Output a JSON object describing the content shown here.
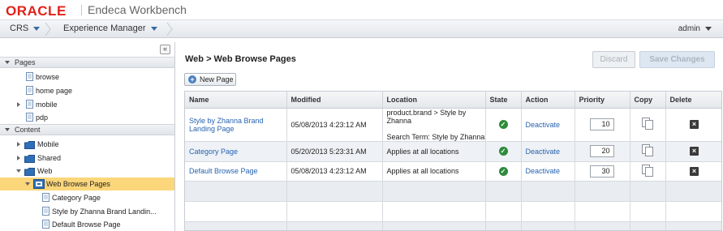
{
  "header": {
    "brand": "ORACLE",
    "product": "Endeca Workbench"
  },
  "nav": {
    "item1": "CRS",
    "item2": "Experience Manager",
    "user": "admin"
  },
  "tree": {
    "pages_header": "Pages",
    "pages": [
      "browse",
      "home page",
      "mobile",
      "pdp"
    ],
    "content_header": "Content",
    "folders": [
      "Mobile",
      "Shared",
      "Web"
    ],
    "selected": "Web Browse Pages",
    "children": [
      "Category Page",
      "Style by Zhanna Brand Landin...",
      "Default Browse Page"
    ]
  },
  "main": {
    "title": "Web > Web Browse Pages",
    "discard": "Discard",
    "save": "Save Changes",
    "new_page": "New Page",
    "columns": [
      "Name",
      "Modified",
      "Location",
      "State",
      "Action",
      "Priority",
      "Copy",
      "Delete"
    ],
    "rows": [
      {
        "name": "Style by Zhanna Brand Landing Page",
        "modified": "05/08/2013 4:23:12 AM",
        "location": "product.brand > Style by Zhanna",
        "location2": "Search Term: Style by Zhanna",
        "action": "Deactivate",
        "priority": "10"
      },
      {
        "name": "Category Page",
        "modified": "05/20/2013 5:23:31 AM",
        "location": "Applies at all locations",
        "action": "Deactivate",
        "priority": "20"
      },
      {
        "name": "Default Browse Page",
        "modified": "05/08/2013 4:23:12 AM",
        "location": "Applies at all locations",
        "action": "Deactivate",
        "priority": "30"
      }
    ]
  },
  "colors": {
    "oracle_red": "#e32119",
    "selection": "#fbd67a",
    "link": "#2763b0",
    "active_green": "#2e8b3a"
  },
  "icons": {
    "collapse": "double-chevron-left-icon",
    "page": "page-icon",
    "folder": "folder-icon",
    "state": "check-circle-icon",
    "copy": "copy-icon",
    "delete": "delete-x-icon",
    "add": "plus-circle-icon"
  }
}
